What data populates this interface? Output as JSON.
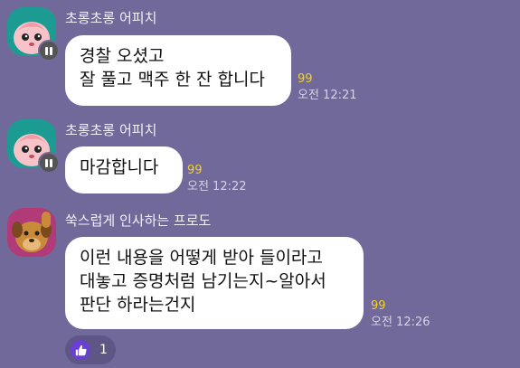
{
  "messages": [
    {
      "sender": "초롱초롱 어피치",
      "lines": [
        "경찰 오셨고",
        "잘 풀고 맥주 한 잔 합니다"
      ],
      "unread": "99",
      "time": "오전 12:21"
    },
    {
      "sender": "초롱초롱 어피치",
      "lines": [
        "마감합니다"
      ],
      "unread": "99",
      "time": "오전 12:22"
    },
    {
      "sender": "쑥스럽게 인사하는 프로도",
      "lines": [
        "이런 내용을 어떻게 받아 들이라고",
        "대놓고 증명처럼 남기는지~알아서",
        "판단 하라는건지"
      ],
      "unread": "99",
      "time": "오전 12:26"
    }
  ],
  "reaction": {
    "icon": "thumbs-up-icon",
    "count": "1"
  },
  "colors": {
    "background": "#72699b",
    "unread": "#f4d21b",
    "bubble": "#ffffff"
  }
}
